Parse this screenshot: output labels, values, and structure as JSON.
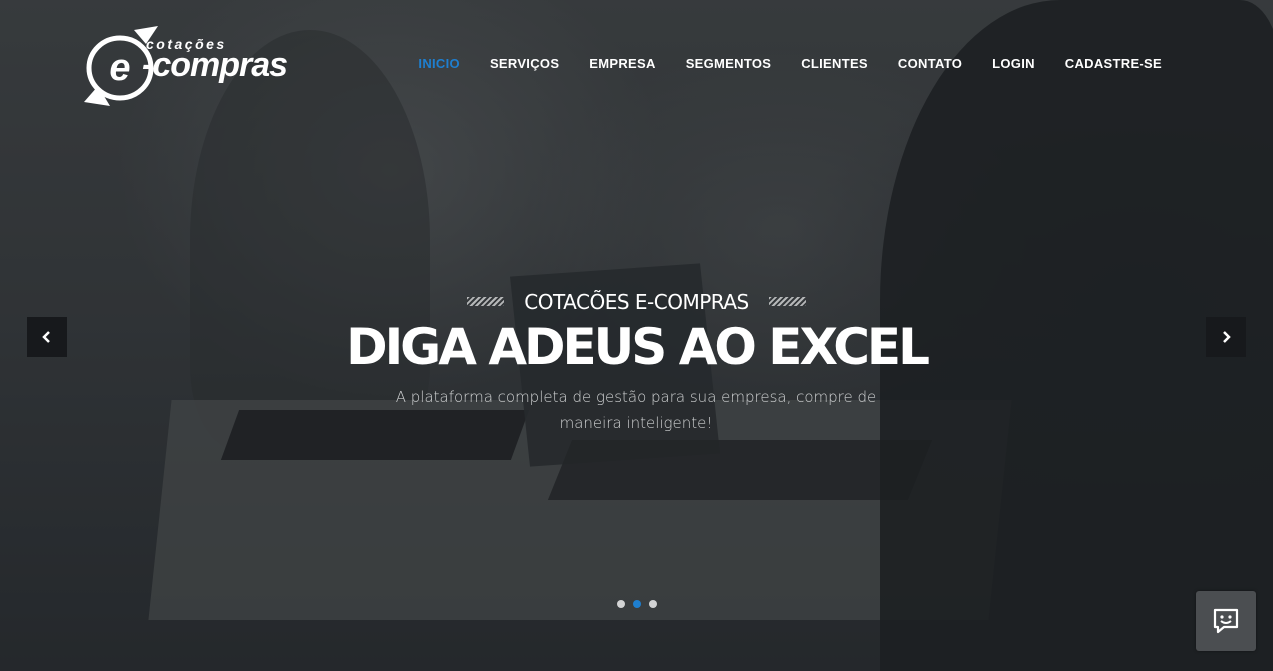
{
  "logo": {
    "small_text": "cotações",
    "main_text": "e-compras"
  },
  "nav": {
    "items": [
      "INICIO",
      "SERVIÇOS",
      "EMPRESA",
      "SEGMENTOS",
      "CLIENTES",
      "CONTATO",
      "LOGIN",
      "CADASTRE-SE"
    ],
    "active_index": 0
  },
  "hero": {
    "pre_title": "COTACÕES E-COMPRAS",
    "title": "DIGA ADEUS AO EXCEL",
    "subtitle": "A plataforma completa de gestão para sua empresa, compre de maneira inteligente!"
  },
  "carousel": {
    "slide_count": 3,
    "active_slide": 2
  },
  "icons": {
    "prev": "chevron-left-icon",
    "next": "chevron-right-icon",
    "chat": "chat-smile-icon"
  },
  "colors": {
    "accent": "#1e7fd0",
    "arrow_bg": "#17191c",
    "chat_bg": "#4b4e51"
  }
}
